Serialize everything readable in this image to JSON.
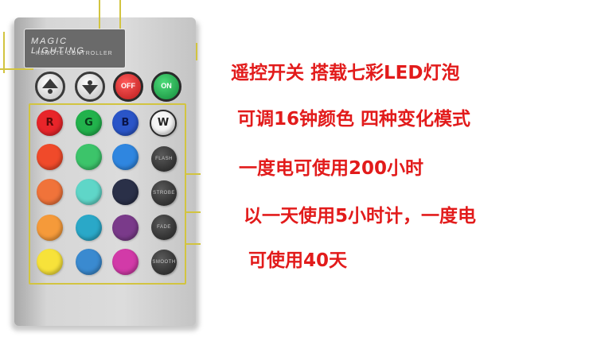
{
  "remote": {
    "brand": "MAGIC LIGHTING",
    "subtitle": "REMOTE CONTROLLER",
    "top_buttons": [
      {
        "name": "brightness-up-button",
        "icon": "brightness-up-icon",
        "color": "#dcdcdc"
      },
      {
        "name": "brightness-down-button",
        "icon": "brightness-down-icon",
        "color": "#dcdcdc"
      },
      {
        "name": "off-button",
        "label": "OFF",
        "color": "#d42a2a"
      },
      {
        "name": "on-button",
        "label": "ON",
        "color": "#1fa84a"
      }
    ],
    "color_buttons": [
      {
        "label": "R",
        "color": "#e8252a"
      },
      {
        "label": "G",
        "color": "#22b24c"
      },
      {
        "label": "B",
        "color": "#2a55c8"
      },
      {
        "label": "W",
        "color": "#f4f4f4"
      }
    ],
    "swatches": [
      [
        "#f04a2a",
        "#3cc46a",
        "#2f86e0"
      ],
      [
        "#f0733a",
        "#5fd6c8",
        "#2a3048"
      ],
      [
        "#f59a3a",
        "#2aa8c8",
        "#7a3a8a"
      ],
      [
        "#f7e23a",
        "#3a8ad0",
        "#d23aa8"
      ]
    ],
    "mode_buttons": [
      "FLASH",
      "STROBE",
      "FADE",
      "SMOOTH"
    ]
  },
  "description_lines": [
    "遥控开关 搭载七彩LED灯泡",
    "可调16钟颜色 四种变化模式",
    "一度电可使用200小时",
    "以一天使用5小时计，一度电",
    "可使用40天"
  ]
}
